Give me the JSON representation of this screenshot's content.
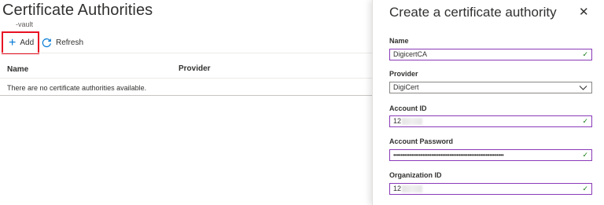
{
  "left": {
    "title": "Certificate Authorities",
    "subtitle": "-vault",
    "toolbar": {
      "add_label": "Add",
      "refresh_label": "Refresh"
    },
    "table": {
      "columns": [
        "Name",
        "Provider"
      ],
      "empty_message": "There are no certificate authorities available."
    }
  },
  "blade": {
    "title": "Create a certificate authority",
    "fields": [
      {
        "label": "Name",
        "value": "DigicertCA",
        "valid": true
      },
      {
        "label": "Provider",
        "value": "DigiCert",
        "type": "select"
      },
      {
        "label": "Account ID",
        "value": "12",
        "redacted": true,
        "valid": true
      },
      {
        "label": "Account Password",
        "value": "•••••••••••••••••••••••••••••••••••••••••••••••••••••••••••••",
        "valid": true
      },
      {
        "label": "Organization ID",
        "value": "12",
        "redacted": true,
        "valid": true
      }
    ]
  },
  "colors": {
    "accent": "#0078d4",
    "highlight": "#e81123",
    "valid": "#107c10",
    "focus_border": "#8a3ab9"
  },
  "icons": {
    "add": "plus-icon",
    "refresh": "refresh-icon",
    "close": "close-icon",
    "check": "check-icon",
    "dropdown": "chevron-down-icon"
  }
}
